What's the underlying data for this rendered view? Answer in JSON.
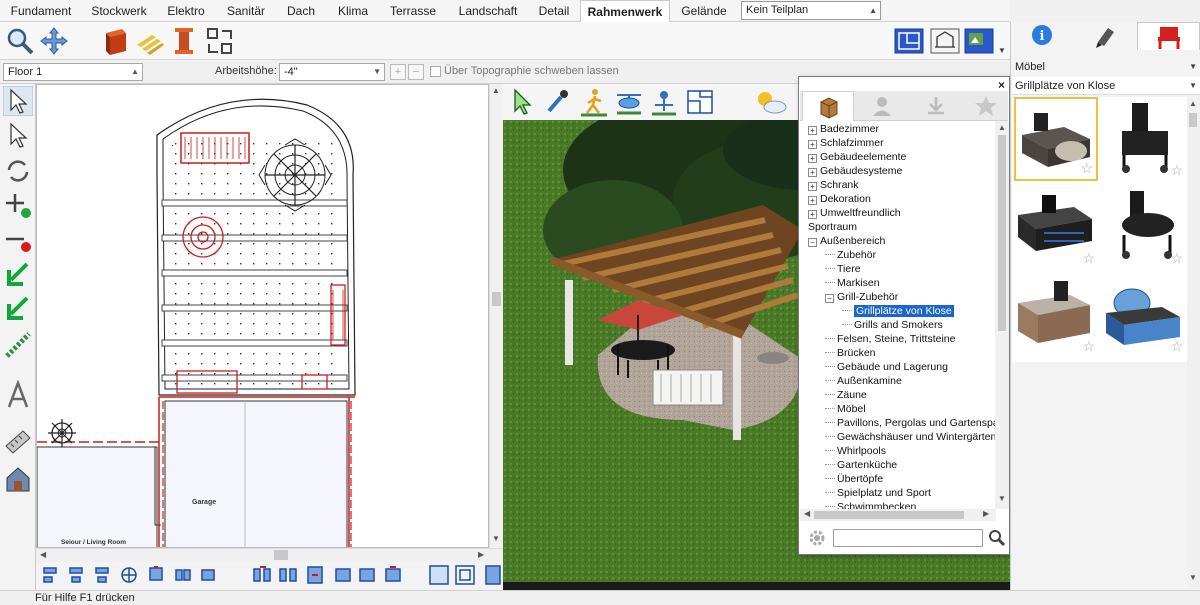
{
  "menu": {
    "tabs": [
      "Fundament",
      "Stockwerk",
      "Elektro",
      "Sanitär",
      "Dach",
      "Klima",
      "Terrasse",
      "Landschaft",
      "Detail",
      "Rahmenwerk",
      "Gelände"
    ],
    "active_tab": "Rahmenwerk",
    "teilplan": "Kein Teilplan"
  },
  "toolbar2": {
    "floor": "Floor 1",
    "arbeitshoehe_label": "Arbeitshöhe:",
    "arbeitshoehe_value": "-4\"",
    "topo_label": "Über Topographie schweben lassen"
  },
  "plan": {
    "garage_label": "Garage",
    "living_label": "Seiour / Living Room"
  },
  "library": {
    "tree": [
      {
        "label": "Badezimmer",
        "level": 0,
        "expander": "+"
      },
      {
        "label": "Schlafzimmer",
        "level": 0,
        "expander": "+"
      },
      {
        "label": "Gebäudeelemente",
        "level": 0,
        "expander": "+"
      },
      {
        "label": "Gebäudesysteme",
        "level": 0,
        "expander": "+"
      },
      {
        "label": "Schrank",
        "level": 0,
        "expander": "+"
      },
      {
        "label": "Dekoration",
        "level": 0,
        "expander": "+"
      },
      {
        "label": "Umweltfreundlich",
        "level": 0,
        "expander": "+"
      },
      {
        "label": "Sportraum",
        "level": 0,
        "expander": ""
      },
      {
        "label": "Außenbereich",
        "level": 0,
        "expander": "−"
      },
      {
        "label": "Zubehör",
        "level": 1,
        "expander": ""
      },
      {
        "label": "Tiere",
        "level": 1,
        "expander": ""
      },
      {
        "label": "Markisen",
        "level": 1,
        "expander": ""
      },
      {
        "label": "Grill-Zubehör",
        "level": 1,
        "expander": "−"
      },
      {
        "label": "Grillplätze von Klose",
        "level": 2,
        "expander": "",
        "selected": true
      },
      {
        "label": "Grills and Smokers",
        "level": 2,
        "expander": ""
      },
      {
        "label": "Felsen, Steine, Trittsteine",
        "level": 1,
        "expander": ""
      },
      {
        "label": "Brücken",
        "level": 1,
        "expander": ""
      },
      {
        "label": "Gebäude und Lagerung",
        "level": 1,
        "expander": ""
      },
      {
        "label": "Außenkamine",
        "level": 1,
        "expander": ""
      },
      {
        "label": "Zäune",
        "level": 1,
        "expander": ""
      },
      {
        "label": "Möbel",
        "level": 1,
        "expander": ""
      },
      {
        "label": "Pavillons, Pergolas und Gartenspal",
        "level": 1,
        "expander": ""
      },
      {
        "label": "Gewächshäuser und Wintergärten",
        "level": 1,
        "expander": ""
      },
      {
        "label": "Whirlpools",
        "level": 1,
        "expander": ""
      },
      {
        "label": "Gartenküche",
        "level": 1,
        "expander": ""
      },
      {
        "label": "Übertöpfe",
        "level": 1,
        "expander": ""
      },
      {
        "label": "Spielplatz und Sport",
        "level": 1,
        "expander": ""
      },
      {
        "label": "Schwimmbecken",
        "level": 1,
        "expander": ""
      }
    ],
    "search_value": ""
  },
  "rightpanel": {
    "category": "Möbel",
    "subcategory": "Grillplätze von Klose"
  },
  "status": "Für Hilfe F1 drücken",
  "colors": {
    "accent": "#1a66cc",
    "grass": "#3f6a22",
    "pergola_wood": "#8a5a2a",
    "selection": "#f0c040"
  }
}
